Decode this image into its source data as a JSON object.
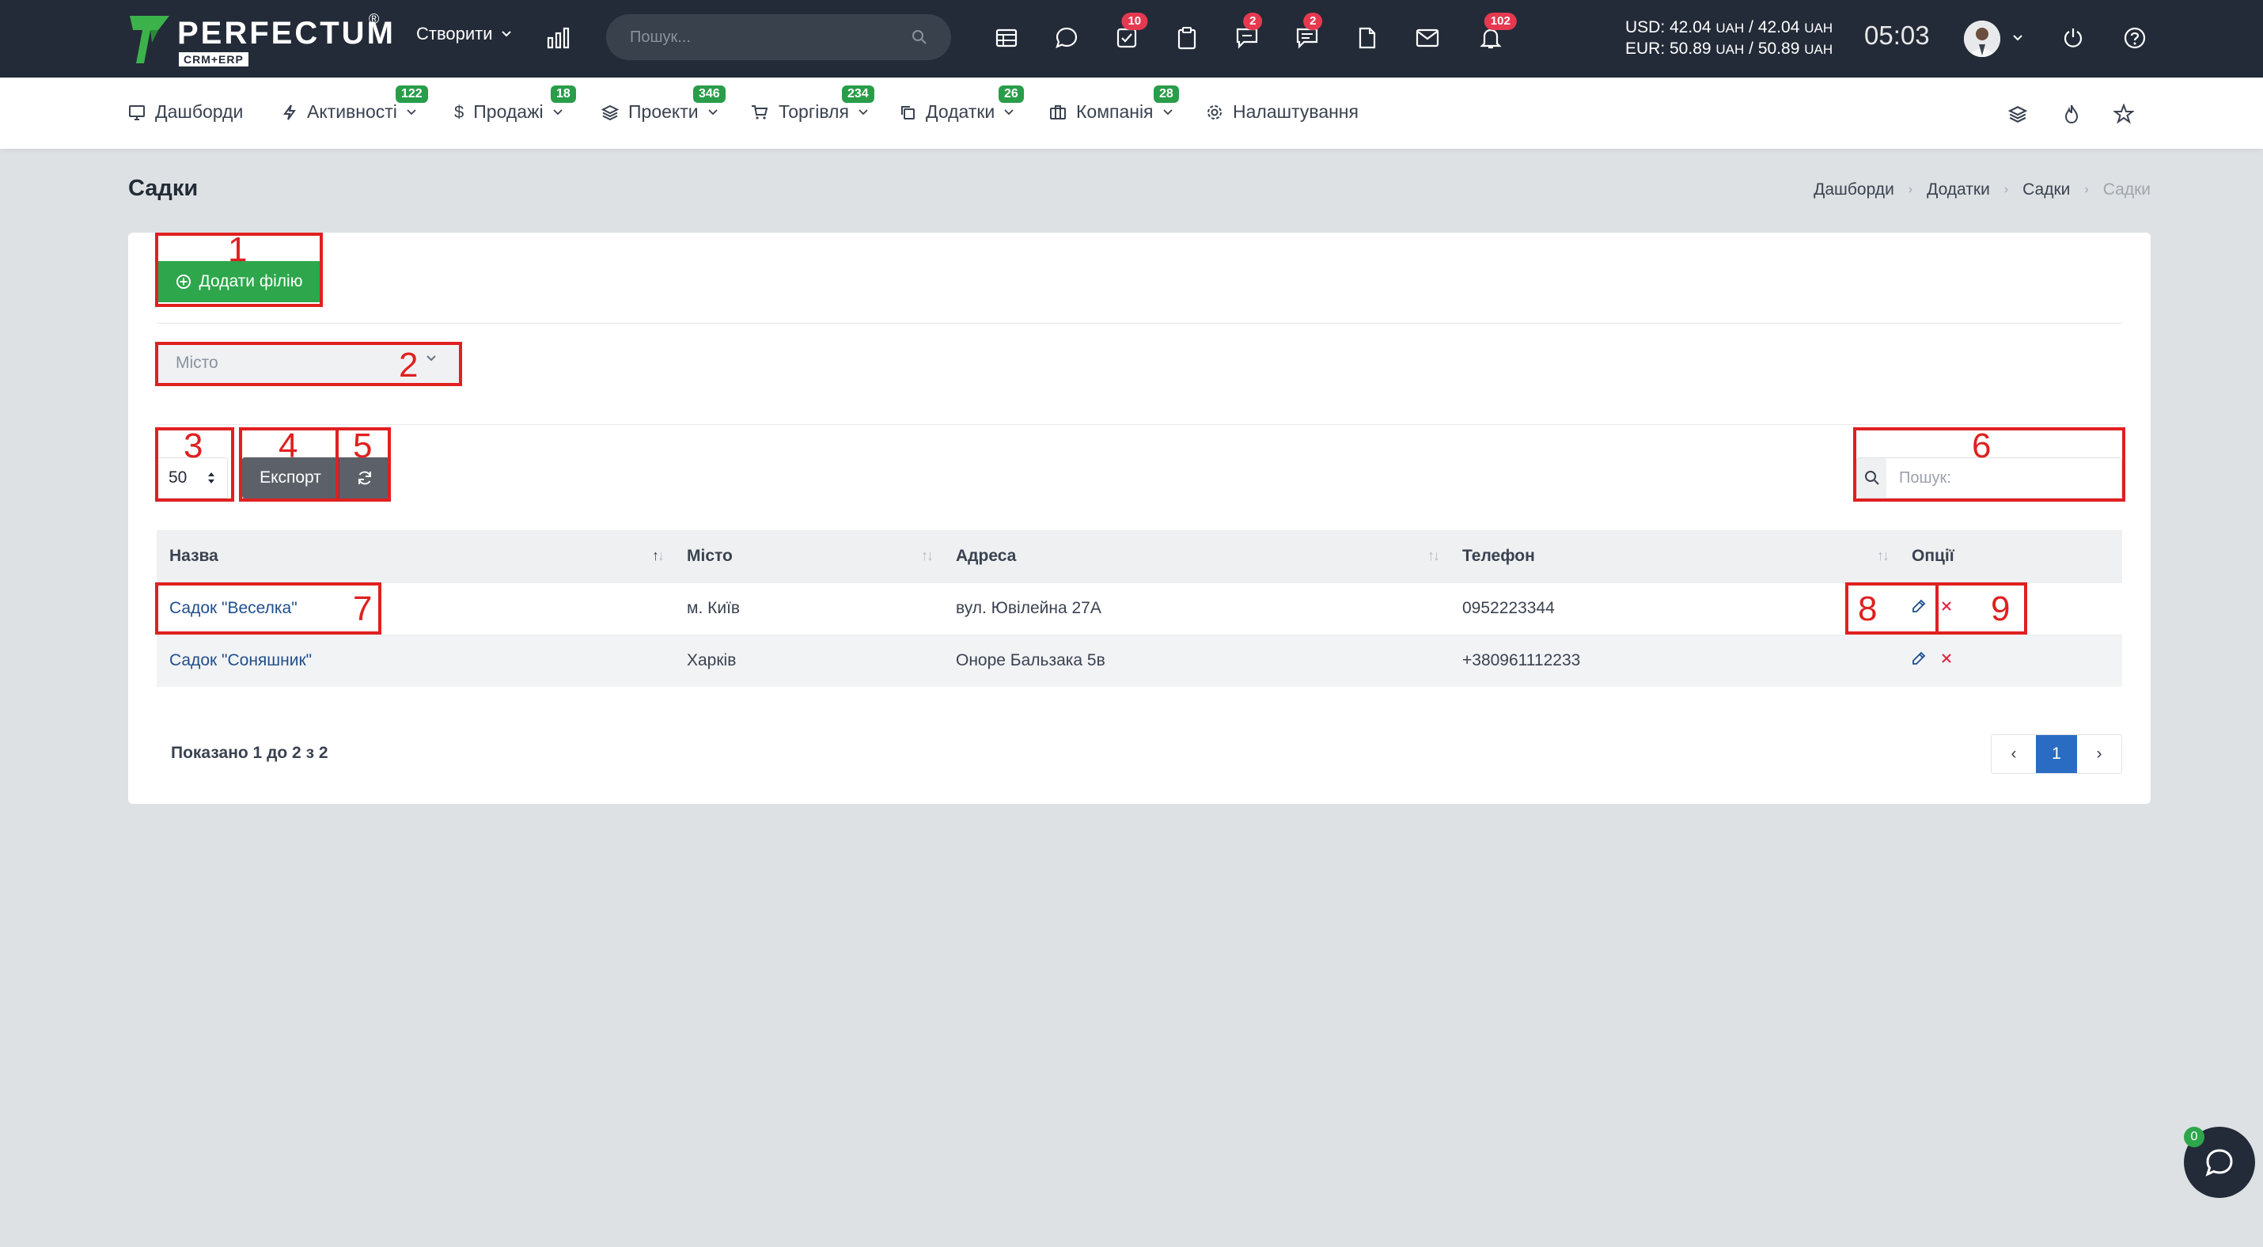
{
  "topbar": {
    "logo_word": "PERFECTUM",
    "logo_reg": "®",
    "logo_sub": "CRM+ERP",
    "create_label": "Створити",
    "search_placeholder": "Пошук...",
    "badges": {
      "tasks": "10",
      "comments": "2",
      "messages": "2",
      "notifications": "102"
    },
    "currency_usd": "USD: 42.04",
    "currency_usd_rest": "UAH / 42.04",
    "currency_eur": "EUR: 50.89",
    "currency_eur_rest": "UAH / 50.89",
    "uah": "UAH",
    "clock": "05:03"
  },
  "nav": {
    "items": [
      {
        "label": "Дашборди",
        "badge": ""
      },
      {
        "label": "Активності",
        "badge": "122"
      },
      {
        "label": "Продажі",
        "badge": "18"
      },
      {
        "label": "Проекти",
        "badge": "346"
      },
      {
        "label": "Торгівля",
        "badge": "234"
      },
      {
        "label": "Додатки",
        "badge": "26"
      },
      {
        "label": "Компанія",
        "badge": "28"
      },
      {
        "label": "Налаштування",
        "badge": ""
      }
    ]
  },
  "page": {
    "title": "Садки",
    "breadcrumb": [
      "Дашборди",
      "Додатки",
      "Садки",
      "Садки"
    ]
  },
  "toolbar": {
    "add_label": "Додати філію",
    "city_placeholder": "Місто",
    "per_page": "50",
    "export_label": "Експорт",
    "search_placeholder": "Пошук:"
  },
  "table": {
    "headers": [
      "Назва",
      "Місто",
      "Адреса",
      "Телефон",
      "Опції"
    ],
    "rows": [
      {
        "name": "Садок \"Веселка\"",
        "city": "м. Київ",
        "address": "вул. Ювілейна 27А",
        "phone": "0952223344"
      },
      {
        "name": "Садок \"Соняшник\"",
        "city": "Харків",
        "address": "Оноре Бальзака 5в",
        "phone": "+380961112233"
      }
    ],
    "shown_text": "Показано 1 до 2 з 2",
    "page": "1"
  },
  "annotations": [
    "1",
    "2",
    "3",
    "4",
    "5",
    "6",
    "7",
    "8",
    "9"
  ],
  "chat": {
    "badge": "0"
  },
  "colors": {
    "accent_green": "#2ea64b",
    "topbar": "#232b38",
    "annotation": "#e02020",
    "link": "#1f4e8c"
  }
}
